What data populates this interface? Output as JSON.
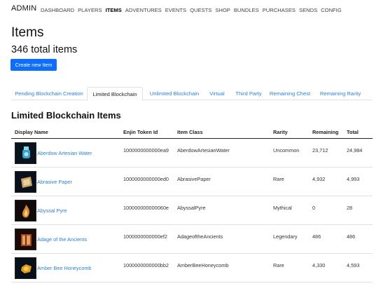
{
  "navbar": {
    "brand": "ADMIN",
    "links": [
      {
        "label": "DASHBOARD"
      },
      {
        "label": "PLAYERS"
      },
      {
        "label": "ITEMS"
      },
      {
        "label": "ADVENTURES"
      },
      {
        "label": "EVENTS"
      },
      {
        "label": "QUESTS"
      },
      {
        "label": "SHOP"
      },
      {
        "label": "BUNDLES"
      },
      {
        "label": "PURCHASES"
      },
      {
        "label": "SENDS"
      },
      {
        "label": "CONFIG"
      }
    ],
    "active": "ITEMS"
  },
  "header": {
    "title": "Items",
    "total": "346 total items",
    "create_button": "Create new Item"
  },
  "tabs": [
    {
      "label": "Pending Blockchain Creation"
    },
    {
      "label": "Limited Blockchain"
    },
    {
      "label": "Unlimited Blockchain"
    },
    {
      "label": "Virtual"
    },
    {
      "label": "Third Party"
    },
    {
      "label": "Remaining Chest"
    },
    {
      "label": "Remaining Rarity"
    }
  ],
  "active_tab": "Limited Blockchain",
  "section": {
    "title": "Limited Blockchain Items"
  },
  "table": {
    "columns": [
      "Display Name",
      "Enjin Token Id",
      "Item Class",
      "Rarity",
      "Remaining",
      "Total"
    ],
    "rows": [
      {
        "name": "Aberdow Artesian Water",
        "token": "1000000000000ea9",
        "class": "AberdowArtesianWater",
        "rarity": "Uncommon",
        "remaining": "23,712",
        "total": "24,984",
        "icon": "water-bottle-icon"
      },
      {
        "name": "Abrasive Paper",
        "token": "1000000000000ed0",
        "class": "AbrasivePaper",
        "rarity": "Rare",
        "remaining": "4,932",
        "total": "4,993",
        "icon": "paper-scroll-icon"
      },
      {
        "name": "Abyssal Pyre",
        "token": "100000000000060e",
        "class": "AbyssalPyre",
        "rarity": "Mythical",
        "remaining": "0",
        "total": "28",
        "icon": "flame-icon"
      },
      {
        "name": "Adage of the Ancients",
        "token": "1000000000000ef2",
        "class": "AdageoftheAncients",
        "rarity": "Legendary",
        "remaining": "486",
        "total": "486",
        "icon": "book-icon"
      },
      {
        "name": "Amber Bee Honeycomb",
        "token": "1000000000000bb2",
        "class": "AmberBeeHoneycomb",
        "rarity": "Rare",
        "remaining": "4,330",
        "total": "4,593",
        "icon": "honeycomb-icon"
      }
    ]
  },
  "colors": {
    "accent": "#0d6efd",
    "link": "#2f7fd3"
  }
}
